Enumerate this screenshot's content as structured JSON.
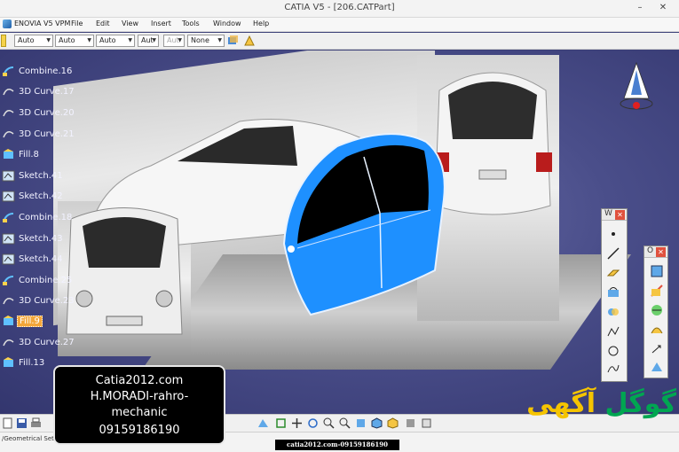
{
  "window": {
    "title": "CATIA V5 - [206.CATPart]",
    "minimize": "–",
    "close": "✕"
  },
  "menu": {
    "items": [
      "ENOVIA V5 VPM",
      "File",
      "Edit",
      "View",
      "Insert",
      "Tools",
      "Window",
      "Help"
    ]
  },
  "toolbar": {
    "combos": [
      "Auto",
      "Auto",
      "Auto",
      "Aut",
      "Aut",
      "None"
    ]
  },
  "tree": {
    "items": [
      {
        "label": "Combine.16",
        "icon": "combine-icon",
        "selected": false
      },
      {
        "label": "3D Curve.17",
        "icon": "curve-icon",
        "selected": false
      },
      {
        "label": "3D Curve.20",
        "icon": "curve-icon",
        "selected": false
      },
      {
        "label": "3D Curve.21",
        "icon": "curve-icon",
        "selected": false
      },
      {
        "label": "Fill.8",
        "icon": "fill-icon",
        "selected": false
      },
      {
        "label": "Sketch.41",
        "icon": "sketch-icon",
        "selected": false
      },
      {
        "label": "Sketch.42",
        "icon": "sketch-icon",
        "selected": false
      },
      {
        "label": "Combine.18",
        "icon": "combine-icon",
        "selected": false
      },
      {
        "label": "Sketch.43",
        "icon": "sketch-icon",
        "selected": false
      },
      {
        "label": "Sketch.44",
        "icon": "sketch-icon",
        "selected": false
      },
      {
        "label": "Combine.25",
        "icon": "combine-icon",
        "selected": false
      },
      {
        "label": "3D Curve.23",
        "icon": "curve-icon",
        "selected": false
      },
      {
        "label": "Fill.9",
        "icon": "fill-icon",
        "selected": true
      },
      {
        "label": "3D Curve.27",
        "icon": "curve-icon",
        "selected": false
      },
      {
        "label": "Fill.13",
        "icon": "fill-icon",
        "selected": false
      }
    ]
  },
  "floating_toolbars": {
    "w_title": "W",
    "o_title": "O"
  },
  "statusbar": {
    "text": "/Geometrical Set"
  },
  "watermark": {
    "line1": "Catia2012.com",
    "line2": "H.MORADI-rahro-",
    "line3": "mechanic",
    "line4": "09159186190",
    "strip": "catia2012.com-09159186190"
  },
  "brand": {
    "text_green": "گوگل",
    "text_yellow": "آگهی"
  },
  "colors": {
    "door_blue": "#1e90ff",
    "selected": "#f3a63a",
    "viewport": "#4a4e8a",
    "brand_green": "#00a651",
    "brand_yellow": "#f5c400"
  }
}
